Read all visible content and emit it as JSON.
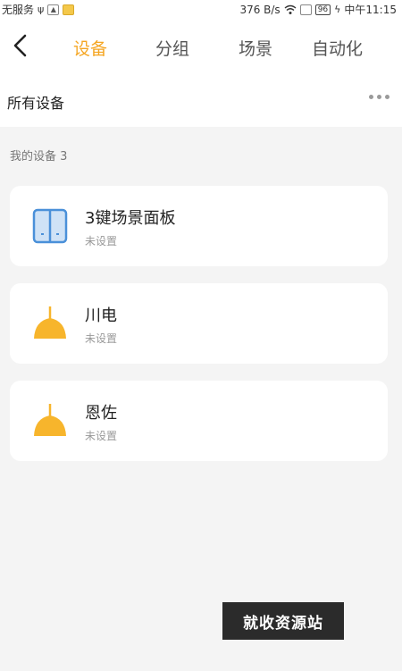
{
  "status_bar": {
    "carrier": "无服务",
    "network_speed": "376 B/s",
    "battery": "96",
    "time": "中午11:15"
  },
  "nav": {
    "tabs": [
      {
        "label": "设备",
        "active": true
      },
      {
        "label": "分组",
        "active": false
      },
      {
        "label": "场景",
        "active": false
      },
      {
        "label": "自动化",
        "active": false
      }
    ]
  },
  "section": {
    "title": "所有设备"
  },
  "device_group": {
    "label": "我的设备 3"
  },
  "devices": [
    {
      "name": "3键场景面板",
      "status": "未设置",
      "icon": "switch-panel-icon"
    },
    {
      "name": "川电",
      "status": "未设置",
      "icon": "ceiling-lamp-icon"
    },
    {
      "name": "恩佐",
      "status": "未设置",
      "icon": "ceiling-lamp-icon"
    }
  ],
  "watermark": {
    "text": "就收资源站"
  },
  "colors": {
    "accent": "#f5a623",
    "lamp": "#f7b52c",
    "panel": "#4a90d9",
    "background": "#f4f4f4"
  }
}
